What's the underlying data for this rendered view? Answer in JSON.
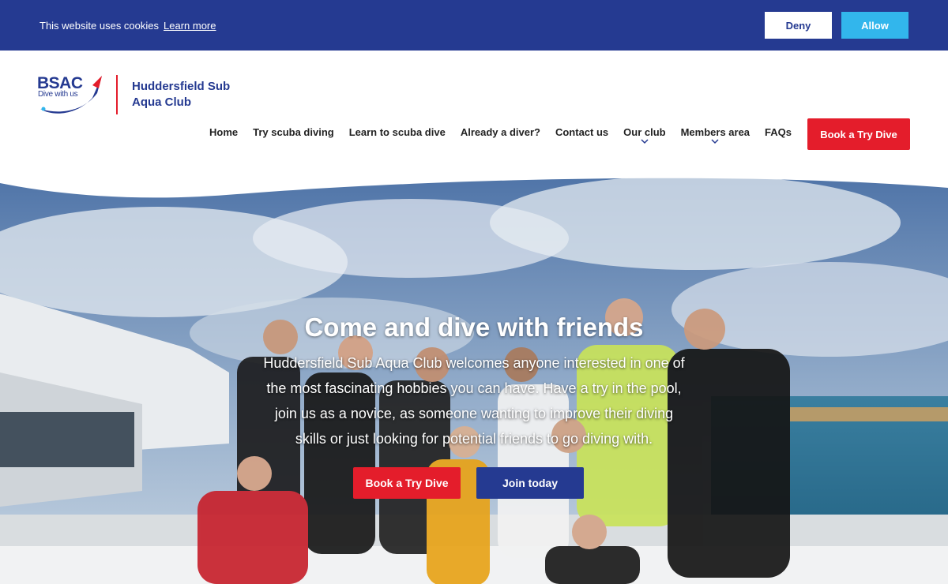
{
  "cookie_bar": {
    "text": "This website uses cookies",
    "learn_more": "Learn more",
    "deny": "Deny",
    "allow": "Allow"
  },
  "header": {
    "logo_text": "BSAC",
    "logo_tagline": "Dive with us",
    "club_name": "Huddersfield Sub Aqua Club",
    "nav": [
      {
        "label": "Home"
      },
      {
        "label": "Try scuba diving"
      },
      {
        "label": "Learn to scuba dive"
      },
      {
        "label": "Already a diver?"
      },
      {
        "label": "Contact us"
      },
      {
        "label": "Our club"
      },
      {
        "label": "Members area"
      },
      {
        "label": "FAQs"
      }
    ],
    "cta": "Book a Try Dive"
  },
  "hero": {
    "title": "Come and dive with friends",
    "text": "Huddersfield Sub Aqua Club welcomes anyone interested in one of the most fascinating hobbies you can have. Have a try in the pool, join us as a novice, as someone wanting to improve their diving skills or just looking for potential friends to go diving with.",
    "book_button": "Book a Try Dive",
    "join_button": "Join today"
  },
  "colors": {
    "brand_blue": "#253a91",
    "brand_red": "#e41d2b",
    "allow_blue": "#32b6ec"
  }
}
